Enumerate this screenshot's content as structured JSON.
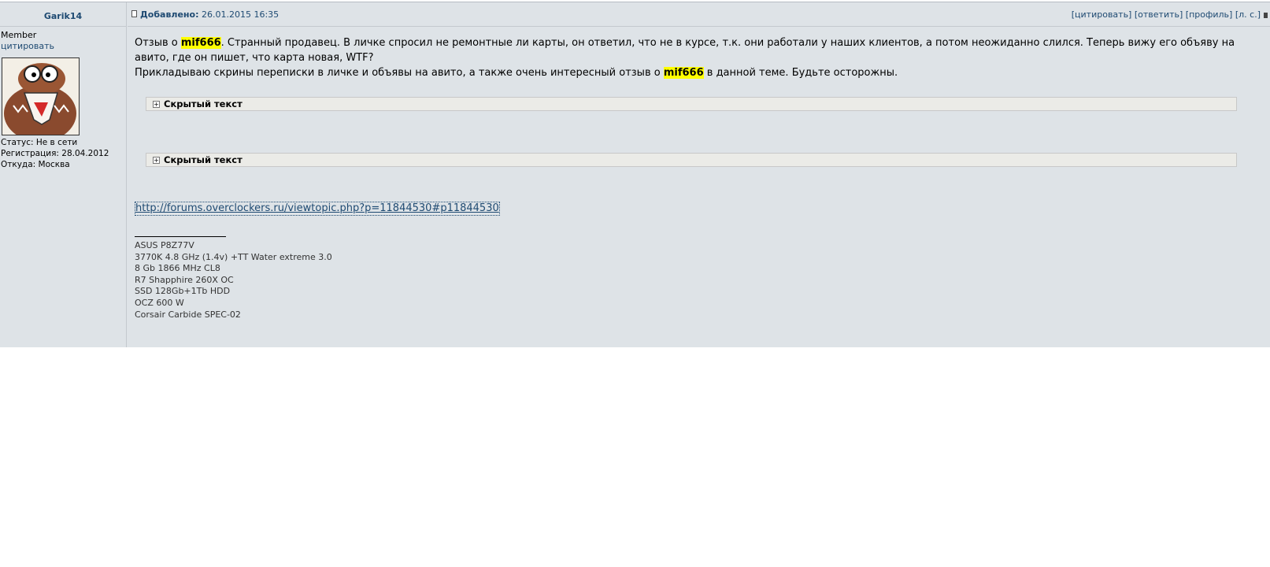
{
  "author": {
    "name": "Garik14",
    "rank": "Member",
    "quote_link": "цитировать",
    "status": "Статус: Не в сети",
    "registered": "Регистрация: 28.04.2012",
    "location": "Откуда: Москва"
  },
  "header": {
    "posted_label": "Добавлено:",
    "posted_date": "26.01.2015 16:35",
    "actions": [
      "[цитировать]",
      "[ответить]",
      "[профиль]",
      "[л. с.]"
    ]
  },
  "message": {
    "p1_a": "Отзыв о ",
    "highlight1": "mif666",
    "p1_b": ". Странный продавец. В личке спросил не ремонтные ли карты, он ответил, что не в курсе, т.к. они работали у наших клиентов, а потом неожиданно слился. Теперь вижу его объяву на авито, где он пишет, что карта новая, WTF?",
    "p2_a": "Прикладываю скрины переписки в личке и объявы на авито, а также очень интересный отзыв о ",
    "highlight2": "mif666",
    "p2_b": " в данной теме. Будьте осторожны.",
    "spoiler1": "Скрытый текст",
    "spoiler2": "Скрытый текст",
    "link": "http://forums.overclockers.ru/viewtopic.php?p=11844530#p11844530"
  },
  "signature": {
    "lines": [
      "ASUS P8Z77V",
      "3770K 4.8 GHz (1.4v) +TT Water extreme 3.0",
      "8 Gb 1866 MHz CL8",
      "R7 Shapphire 260X OC",
      "SSD 128Gb+1Tb HDD",
      "OCZ 600 W",
      "Corsair Carbide SPEC-02"
    ]
  },
  "colors": {
    "post_bg": "#dee3e7",
    "link": "#1e4a72",
    "highlight": "#ffff00"
  }
}
